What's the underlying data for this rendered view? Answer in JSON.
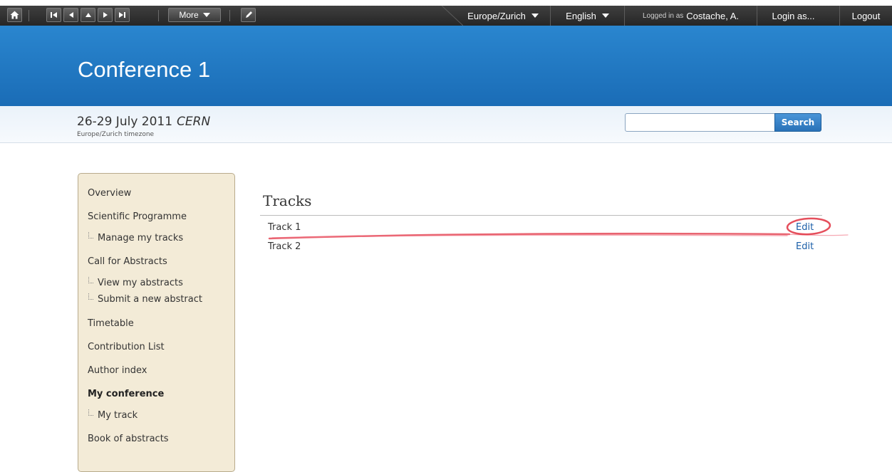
{
  "toolbar": {
    "more_label": "More",
    "timezone": "Europe/Zurich",
    "language": "English",
    "logged_in_prefix": "Logged in as",
    "user_name": "Costache, A.",
    "login_as": "Login as...",
    "logout": "Logout"
  },
  "header": {
    "title": "Conference 1"
  },
  "subheader": {
    "dates": "26-29 July 2011",
    "location": "CERN",
    "timezone_note": "Europe/Zurich timezone",
    "search_value": "",
    "search_button": "Search"
  },
  "sidebar": {
    "items": [
      {
        "label": "Overview"
      },
      {
        "label": "Scientific Programme"
      },
      {
        "label": "Manage my tracks"
      },
      {
        "label": "Call for Abstracts"
      },
      {
        "label": "View my abstracts"
      },
      {
        "label": "Submit a new abstract"
      },
      {
        "label": "Timetable"
      },
      {
        "label": "Contribution List"
      },
      {
        "label": "Author index"
      },
      {
        "label": "My conference"
      },
      {
        "label": "My track"
      },
      {
        "label": "Book of abstracts"
      }
    ]
  },
  "main": {
    "title": "Tracks",
    "tracks": [
      {
        "name": "Track 1",
        "action": "Edit"
      },
      {
        "name": "Track 2",
        "action": "Edit"
      }
    ]
  },
  "colors": {
    "header_blue": "#1a6cb6",
    "sidebar_bg": "#f3ebd7",
    "link_blue": "#1a5ea8",
    "annotation_red": "#e03040"
  },
  "icons": [
    "home-icon",
    "first-icon",
    "previous-icon",
    "up-icon",
    "next-icon",
    "last-icon",
    "pencil-icon"
  ]
}
